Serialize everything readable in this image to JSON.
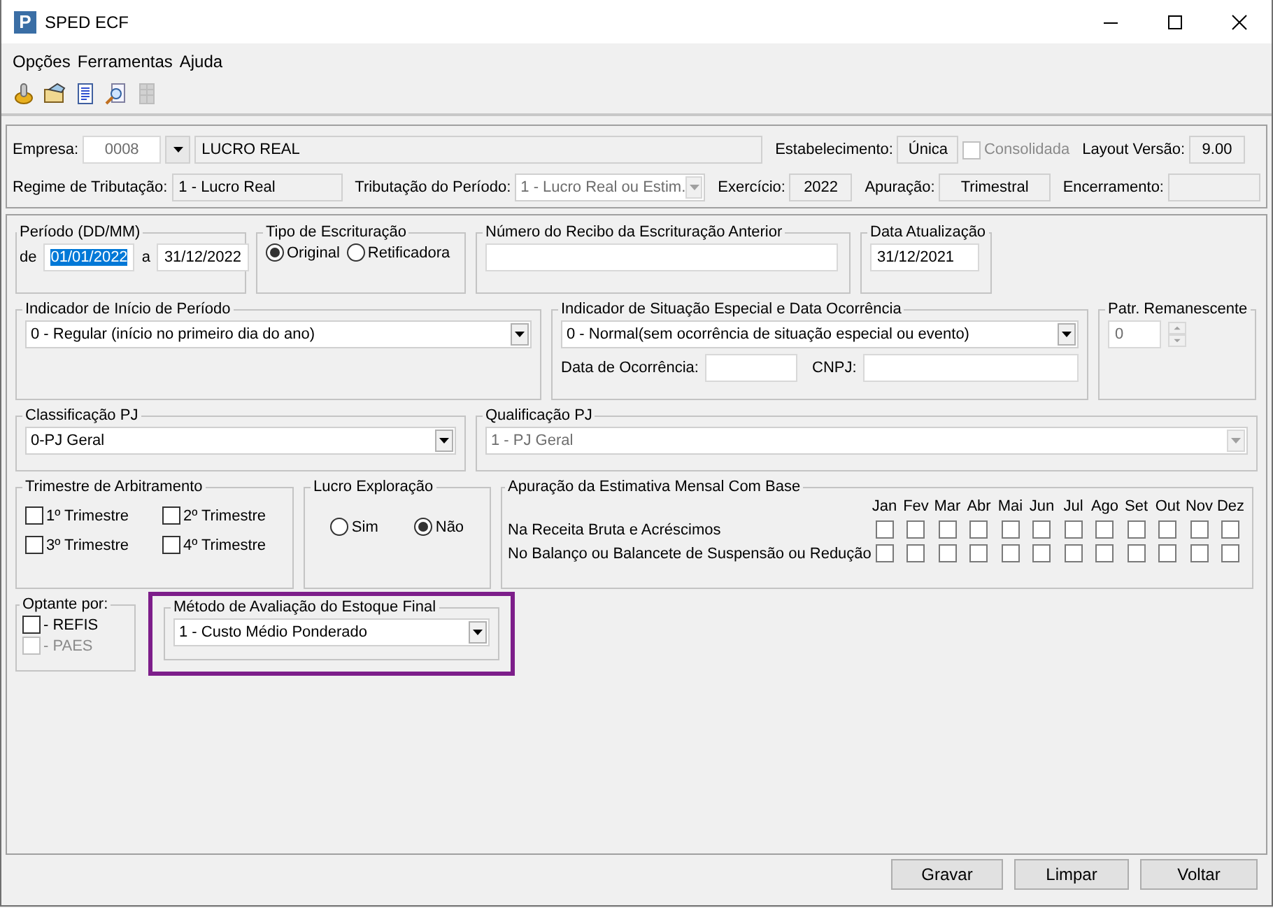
{
  "window": {
    "title": "SPED ECF",
    "icon_letter": "P"
  },
  "menu": [
    "Opções",
    "Ferramentas",
    "Ajuda"
  ],
  "toolbar": [
    {
      "kind": "coins",
      "disabled": false
    },
    {
      "kind": "folder",
      "disabled": false
    },
    {
      "kind": "document",
      "disabled": false
    },
    {
      "kind": "preview",
      "disabled": false
    },
    {
      "kind": "grid",
      "disabled": true
    }
  ],
  "header": {
    "empresa_label": "Empresa:",
    "empresa_code": {
      "value": "0008",
      "disabled": true
    },
    "empresa_name": {
      "value": "LUCRO REAL",
      "readonly": true
    },
    "estabelecimento_label": "Estabelecimento:",
    "estabelecimento": {
      "value": "Única",
      "readonly": true
    },
    "consolidada": {
      "label": "Consolidada",
      "checked": false,
      "disabled": true
    },
    "layout_label": "Layout Versão:",
    "layout": {
      "value": "9.00",
      "readonly": true
    },
    "regime_label": "Regime de Tributação:",
    "regime": {
      "value": "1 - Lucro Real",
      "readonly": true
    },
    "tributacao_label": "Tributação do Período:",
    "tributacao": {
      "value": "1 - Lucro Real ou Estim.",
      "disabled": true
    },
    "exercicio_label": "Exercício:",
    "exercicio": {
      "value": "2022",
      "readonly": true
    },
    "apuracao_label": "Apuração:",
    "apuracao": {
      "value": "Trimestral",
      "readonly": true
    },
    "encerramento_label": "Encerramento:",
    "encerramento": {
      "readonly": true
    }
  },
  "periodo": {
    "title": "Período (DD/MM)",
    "from_label": "de",
    "from": {
      "value": "01/01/2022",
      "selected": true
    },
    "to_label": "a",
    "to": {
      "value": "31/12/2022",
      "selected": false
    }
  },
  "tipo_escrituracao": {
    "title": "Tipo de Escrituração",
    "options": [
      {
        "label": "Original",
        "selected": true
      },
      {
        "label": "Retificadora",
        "selected": false
      }
    ]
  },
  "numero_recibo": {
    "title": "Número do Recibo da Escrituração Anterior"
  },
  "data_atualizacao": {
    "title": "Data Atualização",
    "value": "31/12/2021"
  },
  "indicador_inicio": {
    "title": "Indicador de Início de Período",
    "value": "0 - Regular (início no primeiro dia do ano)"
  },
  "indicador_situacao": {
    "title": "Indicador de Situação Especial e Data Ocorrência",
    "value": "0 - Normal(sem ocorrência de situação especial ou evento)",
    "data_ocorrencia_label": "Data de Ocorrência:",
    "cnpj_label": "CNPJ:"
  },
  "patr_remanescente": {
    "title": "Patr. Remanescente",
    "value": "0",
    "disabled": true
  },
  "classificacao_pj": {
    "title": "Classificação PJ",
    "value": "0-PJ Geral"
  },
  "qualificacao_pj": {
    "title": "Qualificação PJ",
    "value": "1 - PJ Geral",
    "disabled": true
  },
  "trimestre_arbitramento": {
    "title": "Trimestre de Arbitramento",
    "items": [
      {
        "label": "1º Trimestre",
        "checked": false
      },
      {
        "label": "2º Trimestre",
        "checked": false
      },
      {
        "label": "3º Trimestre",
        "checked": false
      },
      {
        "label": "4º Trimestre",
        "checked": false
      }
    ]
  },
  "lucro_exploracao": {
    "title": "Lucro Exploração",
    "options": [
      {
        "label": "Sim",
        "selected": false
      },
      {
        "label": "Não",
        "selected": true
      }
    ]
  },
  "apuracao_estimativa": {
    "title": "Apuração da Estimativa Mensal Com Base",
    "months": [
      "Jan",
      "Fev",
      "Mar",
      "Abr",
      "Mai",
      "Jun",
      "Jul",
      "Ago",
      "Set",
      "Out",
      "Nov",
      "Dez"
    ],
    "rows": [
      {
        "label": "Na Receita Bruta e Acréscimos",
        "checked": [
          false,
          false,
          false,
          false,
          false,
          false,
          false,
          false,
          false,
          false,
          false,
          false
        ]
      },
      {
        "label": "No Balanço ou Balancete de Suspensão ou Redução",
        "checked": [
          false,
          false,
          false,
          false,
          false,
          false,
          false,
          false,
          false,
          false,
          false,
          false
        ]
      }
    ]
  },
  "optante": {
    "title": "Optante por:",
    "items": [
      {
        "label": "- REFIS",
        "checked": false,
        "disabled": false
      },
      {
        "label": "- PAES",
        "checked": false,
        "disabled": true
      }
    ]
  },
  "metodo_estoque": {
    "title": "Método de Avaliação do Estoque Final",
    "value": "1 - Custo Médio Ponderado",
    "highlighted": true
  },
  "buttons": [
    "Gravar",
    "Limpar",
    "Voltar"
  ]
}
